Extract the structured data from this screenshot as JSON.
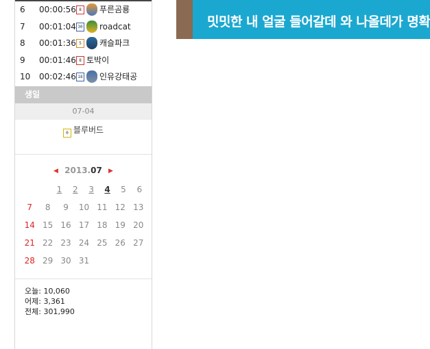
{
  "ranking": [
    {
      "no": "6",
      "time": "00:00:56",
      "level": "8",
      "nick": "푸른곰룡"
    },
    {
      "no": "7",
      "time": "00:01:04",
      "level": "30",
      "nick": "roadcat"
    },
    {
      "no": "8",
      "time": "00:01:36",
      "level": "5",
      "nick": "캐슬파크"
    },
    {
      "no": "9",
      "time": "00:01:46",
      "level": "8",
      "nick": "토박이"
    },
    {
      "no": "10",
      "time": "00:02:46",
      "level": "18",
      "nick": "인유강태공"
    }
  ],
  "birthday": {
    "header": "생일",
    "date": "07-04",
    "user_level": "0",
    "user": "블루버드"
  },
  "calendar": {
    "prev_icon": "◀",
    "next_icon": "▶",
    "year": "2013.",
    "month": "07",
    "weeks": [
      [
        "",
        "",
        "1",
        "2",
        "3",
        "4",
        "5",
        "6"
      ],
      [
        "7",
        "8",
        "9",
        "10",
        "11",
        "12",
        "13"
      ],
      [
        "14",
        "15",
        "16",
        "17",
        "18",
        "19",
        "20"
      ],
      [
        "21",
        "22",
        "23",
        "24",
        "25",
        "26",
        "27"
      ],
      [
        "28",
        "29",
        "30",
        "31",
        "",
        "",
        ""
      ]
    ]
  },
  "stats": {
    "today": "오늘: 10,060",
    "yesterday": "어제: 3,361",
    "total": "전체: 301,990"
  },
  "banner": {
    "text": "밋밋한 내 얼굴 들어갈데 와 나올데가 명확"
  },
  "colors": {
    "banner_bg": "#1ba8d0",
    "sunday": "#dd2222",
    "header_bg": "#c9c9c9"
  }
}
